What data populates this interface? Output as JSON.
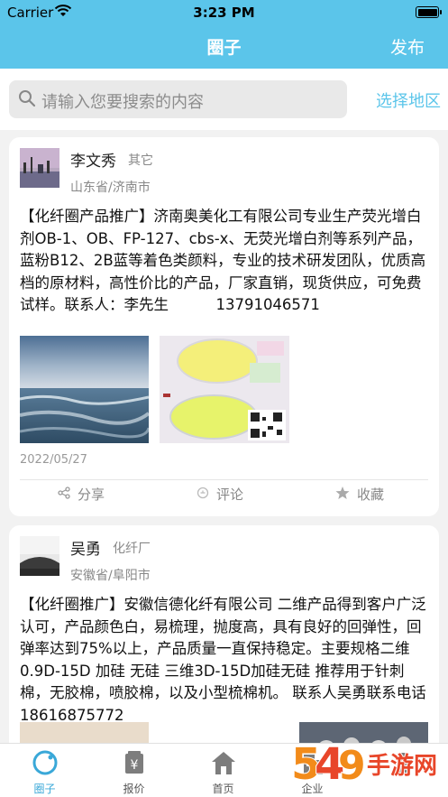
{
  "status_bar": {
    "carrier": "Carrier",
    "time": "3:23 PM"
  },
  "nav": {
    "title": "圈子",
    "publish": "发布"
  },
  "search": {
    "placeholder": "请输入您要搜索的内容",
    "region_button": "选择地区"
  },
  "posts": [
    {
      "user_name": "李文秀",
      "user_tag": "其它",
      "location": "山东省/济南市",
      "text": "【化纤圈产品推广】济南奥美化工有限公司专业生产荧光增白剂OB-1、OB、FP-127、cbs-x、无荧光增白剂等系列产品，蓝粉B12、2B蓝等着色类颜料，专业的技术研发团队，优质高档的原材料，高性价比的产品，厂家直销，现货供应，可免费试样。联系人：李先生          13791046571",
      "date": "2022/05/27",
      "actions": {
        "share": "分享",
        "comment": "评论",
        "favorite": "收藏"
      }
    },
    {
      "user_name": "吴勇",
      "user_tag": "化纤厂",
      "location": "安徽省/阜阳市",
      "text": "【化纤圈推广】安徽信德化纤有限公司 二维产品得到客户广泛认可，产品颜色白，易梳理，抛度高，具有良好的回弹性，回弹率达到75%以上，产品质量一直保持稳定。主要规格二维0.9D-15D 加硅 无硅 三维3D-15D加硅无硅 推荐用于针刺棉，无胶棉，喷胶棉，以及小型梳棉机。 联系人吴勇联系电话18616875772"
    }
  ],
  "tabs": [
    {
      "label": "圈子",
      "icon": "circle-icon",
      "active": true
    },
    {
      "label": "报价",
      "icon": "price-icon"
    },
    {
      "label": "首页",
      "icon": "home-icon"
    },
    {
      "label": "企业",
      "icon": "building-icon"
    },
    {
      "label": "",
      "icon": "mine-icon"
    }
  ],
  "watermark": {
    "text": "手游网"
  },
  "colors": {
    "accent": "#5bc5ea",
    "active_tab": "#3aa8d8"
  }
}
